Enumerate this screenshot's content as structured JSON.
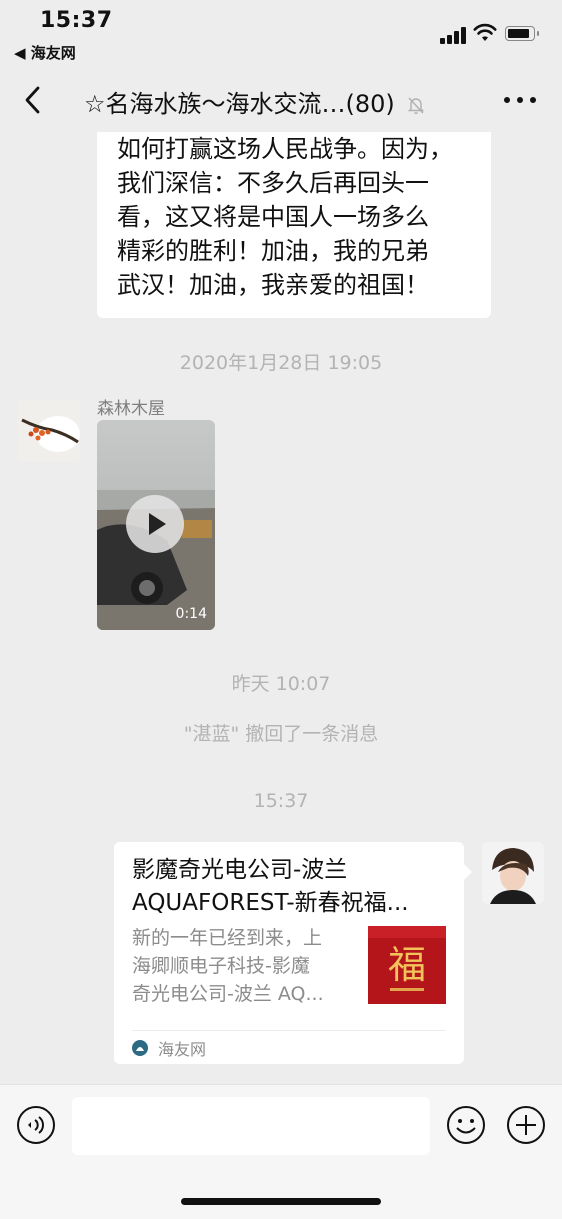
{
  "status_bar": {
    "time": "15:37",
    "back_app_label": "◀ 海友网",
    "icons": [
      "signal-icon",
      "wifi-icon",
      "battery-icon"
    ]
  },
  "nav": {
    "title": "☆名海水族～海水交流…",
    "member_count": "(80)",
    "icons": [
      "back-arrow-icon",
      "mute-bell-icon",
      "more-dots-icon"
    ]
  },
  "messages": {
    "text_lines": [
      "如何打赢这场人民战争。因为，",
      "我们深信：不多久后再回头一",
      "看，这又将是中国人一场多么",
      "精彩的胜利！加油，我的兄弟",
      "武汉！加油，我亲爱的祖国！"
    ],
    "timestamp_1": "2020年1月28日 19:05",
    "sender_name": "森林木屋",
    "video_duration": "0:14",
    "timestamp_2": "昨天 10:07",
    "recall_notice": "\"湛蓝\" 撤回了一条消息",
    "timestamp_3": "15:37"
  },
  "link_card": {
    "title_lines": [
      "影魔奇光电公司-波兰",
      "AQUAFOREST-新春祝福..."
    ],
    "desc_lines": [
      "新的一年已经到来，上",
      "海卿顺电子科技-影魔",
      "奇光电公司-波兰 AQ..."
    ],
    "thumb_char": "福",
    "source": "海友网"
  },
  "input_bar": {
    "placeholder": "",
    "icons": [
      "voice-icon",
      "emoji-icon",
      "plus-icon"
    ]
  },
  "colors": {
    "background": "#ededed",
    "bubble": "#ffffff",
    "muted_text": "#b3b3b3",
    "thumb_red": "#b3151b"
  }
}
